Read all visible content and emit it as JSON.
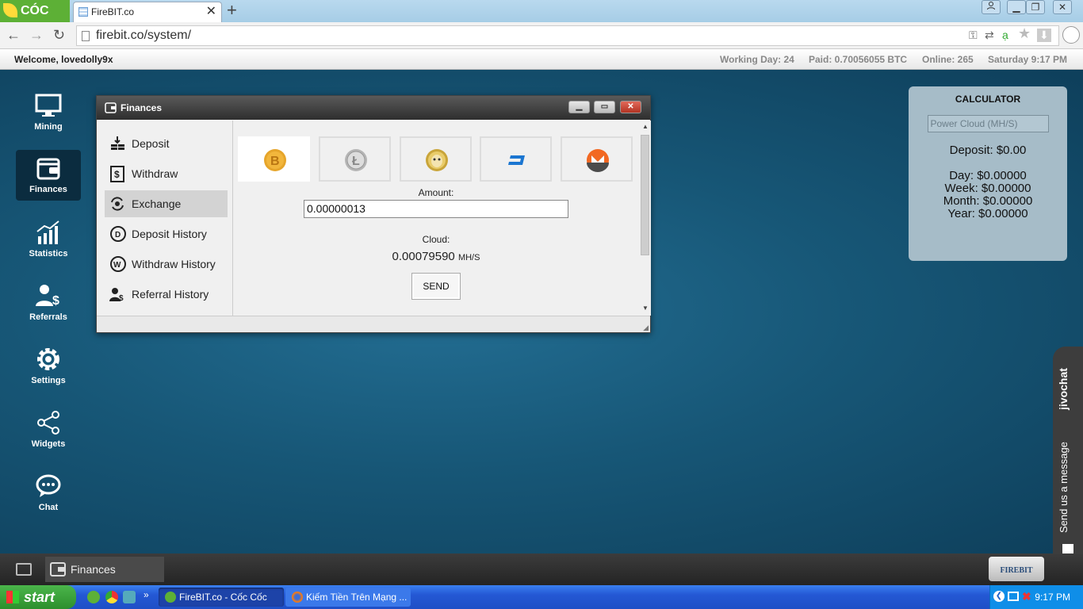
{
  "browser": {
    "brand": "CÓC CÓC",
    "tab_title": "FireBIT.co",
    "tab_close": "✕",
    "new_tab": "+",
    "url": "firebit.co/system/"
  },
  "site_bar": {
    "welcome": "Welcome, lovedolly9x",
    "working_day": "Working Day: 24",
    "paid": "Paid: 0.70056055 BTC",
    "online": "Online: 265",
    "datetime": "Saturday 9:17 PM"
  },
  "sidebar": {
    "items": [
      {
        "label": "Mining"
      },
      {
        "label": "Finances"
      },
      {
        "label": "Statistics"
      },
      {
        "label": "Referrals"
      },
      {
        "label": "Settings"
      },
      {
        "label": "Widgets"
      },
      {
        "label": "Chat"
      }
    ]
  },
  "finances": {
    "title": "Finances",
    "menu": [
      {
        "label": "Deposit"
      },
      {
        "label": "Withdraw"
      },
      {
        "label": "Exchange"
      },
      {
        "label": "Deposit History"
      },
      {
        "label": "Withdraw History"
      },
      {
        "label": "Referral History"
      }
    ],
    "coins": [
      "bitcoin",
      "litecoin",
      "dogecoin",
      "dash",
      "monero"
    ],
    "amount_label": "Amount:",
    "amount_value": "0.00000013",
    "cloud_label": "Cloud:",
    "cloud_value": "0.00079590",
    "cloud_unit": "MH/S",
    "send_label": "SEND"
  },
  "calculator": {
    "title": "CALCULATOR",
    "placeholder": "Power Cloud (MH/S)",
    "deposit": "Deposit: $0.00",
    "day": "Day: $0.00000",
    "week": "Week: $0.00000",
    "month": "Month: $0.00000",
    "year": "Year: $0.00000"
  },
  "jivochat": {
    "brand": "jivochat",
    "message": "Send us a message"
  },
  "site_taskbar": {
    "task_label": "Finances",
    "logo_text": "FIREBIT"
  },
  "os_taskbar": {
    "start": "start",
    "tasks": [
      {
        "label": "FireBIT.co - Cốc Cốc"
      },
      {
        "label": "Kiếm Tiền Trên Mạng ..."
      }
    ],
    "clock": "9:17 PM"
  },
  "colors": {
    "desktop_bg": "#175777",
    "sidebar_active": "#0b2c3f",
    "calc_bg": "#a6bcc8",
    "xp_taskbar": "#2458d4",
    "start_green": "#3a9f3a"
  }
}
